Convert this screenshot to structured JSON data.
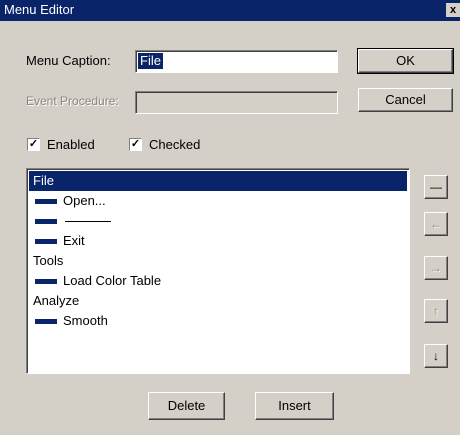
{
  "window": {
    "title": "Menu Editor",
    "close_label": "x"
  },
  "fields": {
    "caption_label": "Menu Caption:",
    "caption_value": "File",
    "event_label": "Event Procedure:",
    "event_value": ""
  },
  "buttons": {
    "ok": "OK",
    "cancel": "Cancel",
    "delete": "Delete",
    "insert": "Insert"
  },
  "checks": {
    "enabled_label": "Enabled",
    "enabled": true,
    "checked_label": "Checked",
    "checked": true
  },
  "menu_items": [
    {
      "label": "File",
      "level": 0,
      "selected": true
    },
    {
      "label": "Open...",
      "level": 1
    },
    {
      "label": "",
      "level": 1,
      "separator": true
    },
    {
      "label": "Exit",
      "level": 1
    },
    {
      "label": "Tools",
      "level": 0
    },
    {
      "label": "Load Color Table",
      "level": 1
    },
    {
      "label": "Analyze",
      "level": 0
    },
    {
      "label": "Smooth",
      "level": 1
    }
  ],
  "side_buttons": [
    {
      "name": "insert-separator-button",
      "glyph": "—",
      "enabled": true
    },
    {
      "name": "move-left-button",
      "glyph": "←",
      "enabled": false
    },
    {
      "name": "move-right-button",
      "glyph": "→",
      "enabled": false
    },
    {
      "name": "move-up-button",
      "glyph": "↑",
      "enabled": false
    },
    {
      "name": "move-down-button",
      "glyph": "↓",
      "enabled": true
    }
  ]
}
